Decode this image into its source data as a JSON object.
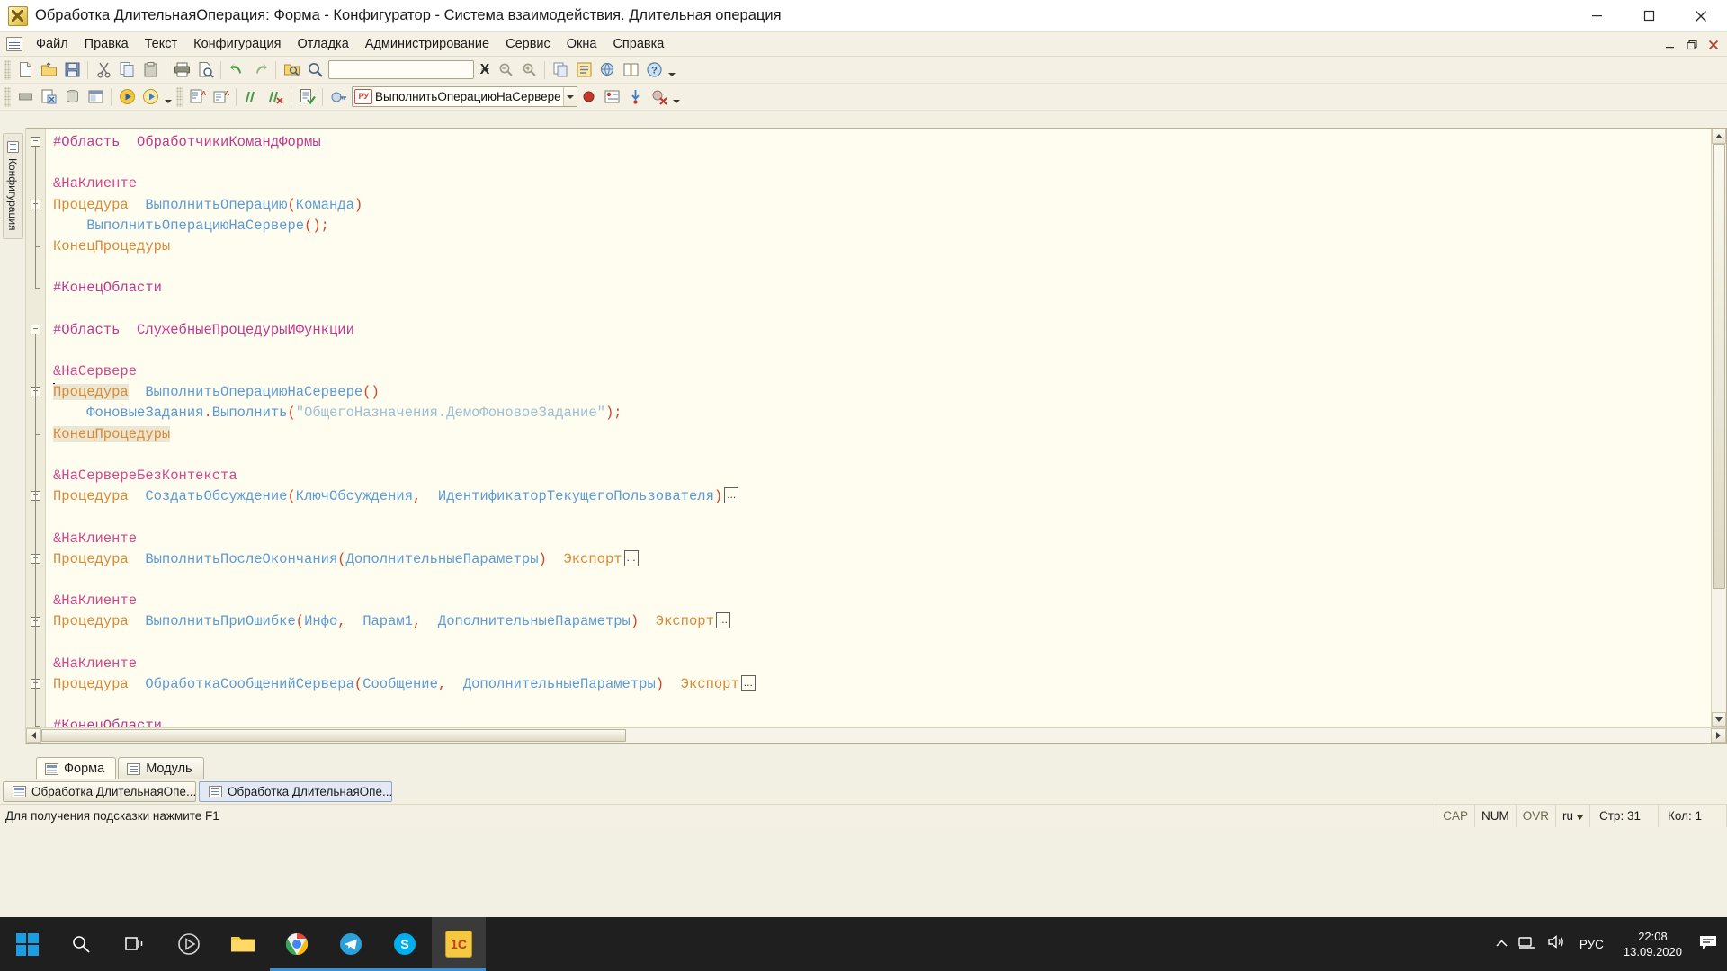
{
  "window": {
    "title": "Обработка ДлительнаяОперация: Форма - Конфигуратор - Система взаимодействия. Длительная операция",
    "app_icon": "1c-document-icon",
    "minimize": "minimize-icon",
    "maximize": "maximize-icon",
    "close": "close-icon"
  },
  "menu": {
    "system_icon": "module-icon",
    "items": [
      {
        "label": "Файл",
        "accel": "Ф"
      },
      {
        "label": "Правка",
        "accel": "П"
      },
      {
        "label": "Текст",
        "accel": ""
      },
      {
        "label": "Конфигурация",
        "accel": ""
      },
      {
        "label": "Отладка",
        "accel": ""
      },
      {
        "label": "Администрирование",
        "accel": ""
      },
      {
        "label": "Сервис",
        "accel": "С"
      },
      {
        "label": "Окна",
        "accel": "О"
      },
      {
        "label": "Справка",
        "accel": ""
      }
    ],
    "right_buttons": [
      "child-restore-down-icon",
      "child-maximize-icon",
      "child-close-icon"
    ]
  },
  "toolbar_main": {
    "buttons": [
      "new-document-icon",
      "open-folder-icon",
      "save-icon",
      "cut-scissors-icon",
      "copy-icon",
      "paste-icon",
      "print-icon",
      "print-preview-icon",
      "undo-arrow-icon",
      "redo-arrow-icon",
      "find-in-folder-icon",
      "search-magnifier-icon"
    ],
    "find_value": "",
    "find_placeholder": "",
    "find_dropdown": "chevron-down-icon",
    "clear_find": "X",
    "after_find_buttons": [
      "find-previous-icon",
      "find-next-icon",
      "compare-windows-icon",
      "configuration-tree-icon",
      "global-search-icon",
      "syntax-assistant-icon",
      "help-question-icon"
    ],
    "overflow": "toolbar-overflow-icon"
  },
  "toolbar_debug": {
    "buttons": [
      "stop-debug-icon",
      "database-config-icon",
      "db-update-icon",
      "windows-layout-icon",
      "start-debug-icon",
      "start-debug-client-icon"
    ],
    "dropdown": "chevron-down-icon",
    "buttons2": [
      "go-to-procedure-icon",
      "go-to-function-icon",
      "comment-block-icon",
      "uncomment-block-icon",
      "syntax-check-icon",
      "module-password-icon"
    ],
    "module_combo": {
      "tag": "РУ",
      "value": "ВыполнитьОперациюНаСервере",
      "dropdown": "chevron-down-icon"
    },
    "buttons3": [
      "set-breakpoint-icon",
      "breakpoint-list-icon",
      "step-into-icon",
      "remove-all-breakpoints-icon"
    ],
    "overflow": "toolbar-overflow-icon"
  },
  "left_dock": {
    "tab_label": "Конфигурация",
    "tab_icon": "configuration-icon"
  },
  "editor": {
    "lines": [
      {
        "fold": "minus",
        "segs": [
          {
            "t": "#Область",
            "c": "c-pre"
          },
          {
            "t": "  ",
            "c": "c-plain"
          },
          {
            "t": "ОбработчикиКомандФормы",
            "c": "c-pre"
          }
        ]
      },
      {
        "fold": "",
        "segs": []
      },
      {
        "fold": "",
        "segs": [
          {
            "t": "&НаКлиенте",
            "c": "c-dir"
          }
        ]
      },
      {
        "fold": "minus",
        "segs": [
          {
            "t": "Процедура",
            "c": "c-kw"
          },
          {
            "t": "  ",
            "c": "c-plain"
          },
          {
            "t": "ВыполнитьОперацию",
            "c": "c-id"
          },
          {
            "t": "(",
            "c": "c-punc"
          },
          {
            "t": "Команда",
            "c": "c-id"
          },
          {
            "t": ")",
            "c": "c-punc"
          }
        ]
      },
      {
        "fold": "",
        "segs": [
          {
            "t": "    ",
            "c": "c-plain"
          },
          {
            "t": "ВыполнитьОперациюНаСервере",
            "c": "c-id"
          },
          {
            "t": "()",
            "c": "c-punc"
          },
          {
            "t": ";",
            "c": "c-punc"
          }
        ]
      },
      {
        "fold": "end",
        "segs": [
          {
            "t": "КонецПроцедуры",
            "c": "c-kw"
          }
        ]
      },
      {
        "fold": "",
        "segs": []
      },
      {
        "fold": "endcap",
        "segs": [
          {
            "t": "#КонецОбласти",
            "c": "c-pre"
          }
        ]
      },
      {
        "fold": "",
        "segs": []
      },
      {
        "fold": "minus",
        "segs": [
          {
            "t": "#Область",
            "c": "c-pre"
          },
          {
            "t": "  ",
            "c": "c-plain"
          },
          {
            "t": "СлужебныеПроцедурыИФункции",
            "c": "c-pre"
          }
        ]
      },
      {
        "fold": "",
        "segs": []
      },
      {
        "fold": "",
        "segs": [
          {
            "t": "&НаСервере",
            "c": "c-dir"
          }
        ]
      },
      {
        "fold": "minus",
        "caret": true,
        "segs": [
          {
            "t": "Процедура",
            "c": "c-kw hl"
          },
          {
            "t": "  ",
            "c": "c-plain"
          },
          {
            "t": "ВыполнитьОперациюНаСервере",
            "c": "c-id"
          },
          {
            "t": "()",
            "c": "c-punc"
          }
        ]
      },
      {
        "fold": "",
        "segs": [
          {
            "t": "    ",
            "c": "c-plain"
          },
          {
            "t": "ФоновыеЗадания",
            "c": "c-id"
          },
          {
            "t": ".",
            "c": "c-punc"
          },
          {
            "t": "Выполнить",
            "c": "c-id"
          },
          {
            "t": "(",
            "c": "c-punc"
          },
          {
            "t": "\"ОбщегоНазначения.ДемоФоновоеЗадание\"",
            "c": "c-str"
          },
          {
            "t": ");",
            "c": "c-punc"
          }
        ]
      },
      {
        "fold": "end",
        "segs": [
          {
            "t": "КонецПроцедуры",
            "c": "c-kw hl"
          }
        ]
      },
      {
        "fold": "",
        "segs": []
      },
      {
        "fold": "",
        "segs": [
          {
            "t": "&НаСервереБезКонтекста",
            "c": "c-dir"
          }
        ]
      },
      {
        "fold": "plus",
        "collapsed": true,
        "segs": [
          {
            "t": "Процедура",
            "c": "c-kw"
          },
          {
            "t": "  ",
            "c": "c-plain"
          },
          {
            "t": "СоздатьОбсуждение",
            "c": "c-id"
          },
          {
            "t": "(",
            "c": "c-punc"
          },
          {
            "t": "КлючОбсуждения",
            "c": "c-id"
          },
          {
            "t": ",  ",
            "c": "c-punc"
          },
          {
            "t": "ИдентификаторТекущегоПользователя",
            "c": "c-id"
          },
          {
            "t": ")",
            "c": "c-punc"
          }
        ]
      },
      {
        "fold": "",
        "segs": []
      },
      {
        "fold": "",
        "segs": [
          {
            "t": "&НаКлиенте",
            "c": "c-dir"
          }
        ]
      },
      {
        "fold": "plus",
        "collapsed": true,
        "segs": [
          {
            "t": "Процедура",
            "c": "c-kw"
          },
          {
            "t": "  ",
            "c": "c-plain"
          },
          {
            "t": "ВыполнитьПослеОкончания",
            "c": "c-id"
          },
          {
            "t": "(",
            "c": "c-punc"
          },
          {
            "t": "ДополнительныеПараметры",
            "c": "c-id"
          },
          {
            "t": ")",
            "c": "c-punc"
          },
          {
            "t": "  ",
            "c": "c-plain"
          },
          {
            "t": "Экспорт",
            "c": "c-kw"
          }
        ]
      },
      {
        "fold": "",
        "segs": []
      },
      {
        "fold": "",
        "segs": [
          {
            "t": "&НаКлиенте",
            "c": "c-dir"
          }
        ]
      },
      {
        "fold": "plus",
        "collapsed": true,
        "segs": [
          {
            "t": "Процедура",
            "c": "c-kw"
          },
          {
            "t": "  ",
            "c": "c-plain"
          },
          {
            "t": "ВыполнитьПриОшибке",
            "c": "c-id"
          },
          {
            "t": "(",
            "c": "c-punc"
          },
          {
            "t": "Инфо",
            "c": "c-id"
          },
          {
            "t": ",  ",
            "c": "c-punc"
          },
          {
            "t": "Парам1",
            "c": "c-id"
          },
          {
            "t": ",  ",
            "c": "c-punc"
          },
          {
            "t": "ДополнительныеПараметры",
            "c": "c-id"
          },
          {
            "t": ")",
            "c": "c-punc"
          },
          {
            "t": "  ",
            "c": "c-plain"
          },
          {
            "t": "Экспорт",
            "c": "c-kw"
          }
        ]
      },
      {
        "fold": "",
        "segs": []
      },
      {
        "fold": "",
        "segs": [
          {
            "t": "&НаКлиенте",
            "c": "c-dir"
          }
        ]
      },
      {
        "fold": "plus",
        "collapsed": true,
        "segs": [
          {
            "t": "Процедура",
            "c": "c-kw"
          },
          {
            "t": "  ",
            "c": "c-plain"
          },
          {
            "t": "ОбработкаСообщенийСервера",
            "c": "c-id"
          },
          {
            "t": "(",
            "c": "c-punc"
          },
          {
            "t": "Сообщение",
            "c": "c-id"
          },
          {
            "t": ",  ",
            "c": "c-punc"
          },
          {
            "t": "ДополнительныеПараметры",
            "c": "c-id"
          },
          {
            "t": ")",
            "c": "c-punc"
          },
          {
            "t": "  ",
            "c": "c-plain"
          },
          {
            "t": "Экспорт",
            "c": "c-kw"
          }
        ]
      },
      {
        "fold": "",
        "segs": []
      },
      {
        "fold": "endcap",
        "segs": [
          {
            "t": "#КонецОбласти",
            "c": "c-pre"
          }
        ]
      }
    ],
    "collapsed_marker": "...",
    "colors": {
      "preprocessor": "#c0398d",
      "directive": "#d1478c",
      "keyword": "#d98a36",
      "identifier": "#5b9bd5",
      "punctuation": "#d0432a",
      "string": "#9bbfd4",
      "background": "#fffdf0",
      "highlight": "#ece7d2"
    }
  },
  "doc_tabs": [
    {
      "label": "Форма",
      "icon": "form-icon",
      "active": true
    },
    {
      "label": "Модуль",
      "icon": "module-icon",
      "active": false
    }
  ],
  "window_list": [
    {
      "label": "Обработка ДлительнаяОпе...",
      "icon": "form-window-icon",
      "active": false
    },
    {
      "label": "Обработка ДлительнаяОпе...",
      "icon": "module-window-icon",
      "active": true
    }
  ],
  "statusbar": {
    "message": "Для получения подсказки нажмите F1",
    "cells": [
      {
        "label": "CAP",
        "active": false
      },
      {
        "label": "NUM",
        "active": true
      },
      {
        "label": "OVR",
        "active": false
      },
      {
        "label": "ru",
        "active": true,
        "dropdown": true
      },
      {
        "label": "Стр: 31",
        "active": true
      },
      {
        "label": "Кол: 1",
        "active": true
      }
    ]
  },
  "taskbar": {
    "start": "windows-logo-icon",
    "items": [
      {
        "icon": "search-icon",
        "name": "search-taskbar-icon"
      },
      {
        "icon": "task-view-icon",
        "name": "task-view-icon"
      },
      {
        "icon": "cortana-icon",
        "name": "media-player-icon"
      },
      {
        "icon": "folder-icon",
        "name": "file-explorer-icon"
      },
      {
        "icon": "chrome-icon",
        "name": "chrome-icon"
      },
      {
        "icon": "telegram-icon",
        "name": "telegram-icon"
      },
      {
        "icon": "skype-icon",
        "name": "skype-icon"
      },
      {
        "icon": "onec-icon",
        "name": "1c-enterprise-icon",
        "label": "1C",
        "active": true
      }
    ],
    "tray": {
      "expand": "chevron-up-icon",
      "network": "network-icon",
      "volume": "speaker-icon",
      "language": "РУС",
      "time": "22:08",
      "date": "13.09.2020",
      "notifications": "notification-icon"
    }
  }
}
